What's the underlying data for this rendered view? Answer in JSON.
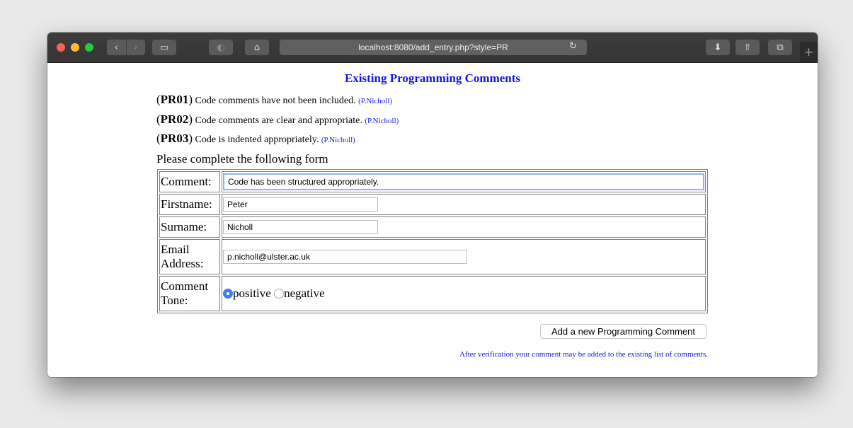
{
  "browser": {
    "url": "localhost:8080/add_entry.php?style=PR",
    "new_tab_icon": "+"
  },
  "page": {
    "heading": "Existing Programming Comments",
    "comments": [
      {
        "code": "PR01",
        "text": "Code comments have not been included.",
        "author": "(P.Nicholl)"
      },
      {
        "code": "PR02",
        "text": "Code comments are clear and appropriate.",
        "author": "(P.Nicholl)"
      },
      {
        "code": "PR03",
        "text": "Code is indented appropriately.",
        "author": "(P.Nicholl)"
      }
    ],
    "prompt": "Please complete the following form"
  },
  "form": {
    "comment_label": "Comment:",
    "comment_value": "Code has been structured appropriately.",
    "firstname_label": "Firstname:",
    "firstname_value": "Peter",
    "surname_label": "Surname:",
    "surname_value": "Nicholl",
    "email_label": "Email Address:",
    "email_value": "p.nicholl@ulster.ac.uk",
    "tone_label": "Comment Tone:",
    "tone_positive": "positive",
    "tone_negative": "negative",
    "tone_selected": "positive",
    "submit_label": "Add a new Programming Comment",
    "note": "After verification your comment may be added to the existing list of comments."
  },
  "colors": {
    "link_blue": "#1414e6",
    "radio_selected": "#3b82f6"
  }
}
